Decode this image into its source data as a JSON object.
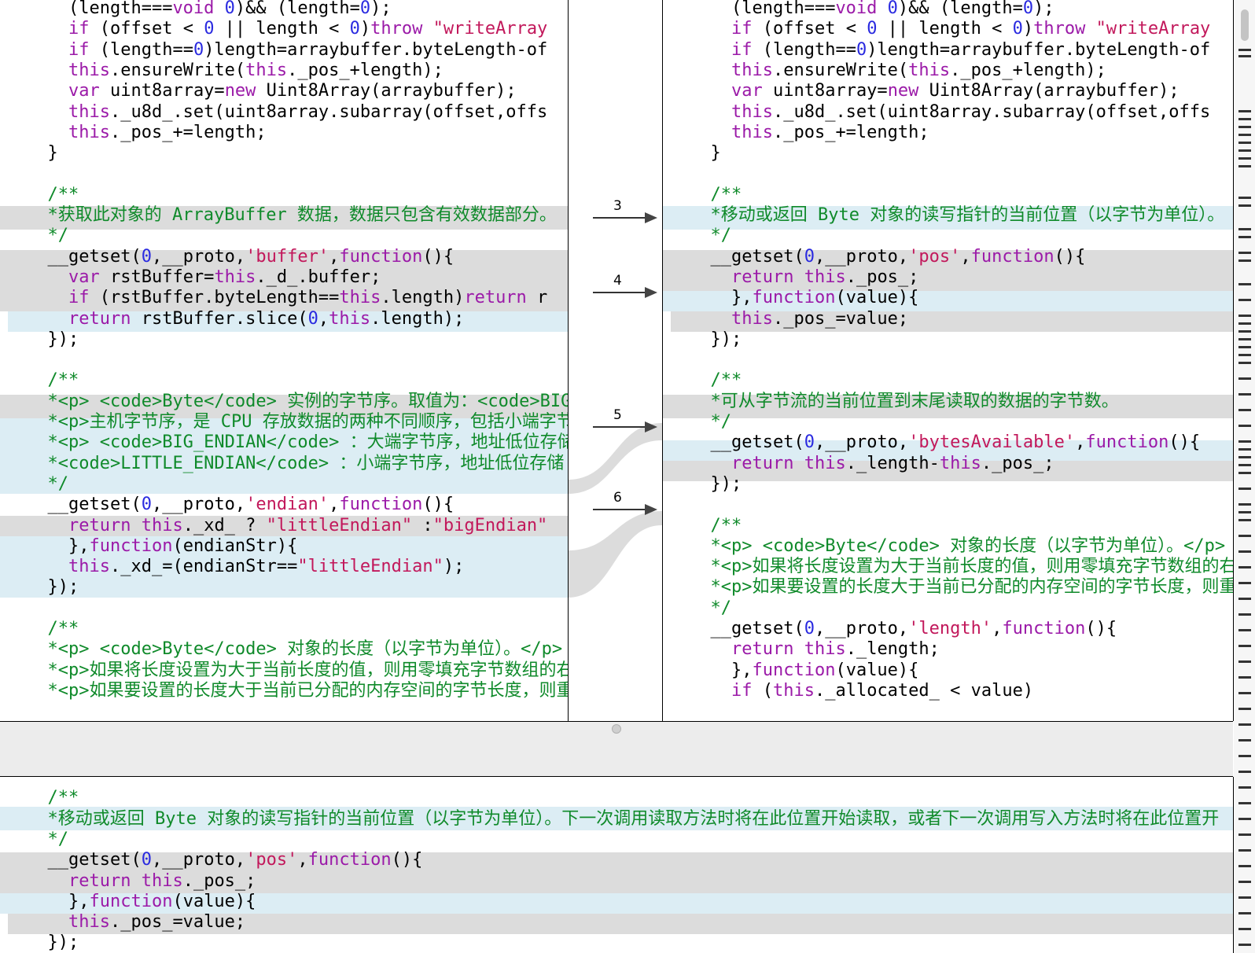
{
  "left_pane": {
    "lines": [
      {
        "indent": "    ",
        "segs": [
          [
            "t",
            "(length==="
          ],
          [
            "kw",
            "void"
          ],
          [
            "t",
            " "
          ],
          [
            "num",
            "0"
          ],
          [
            "t",
            ")&& (length="
          ],
          [
            "num",
            "0"
          ],
          [
            "t",
            ");"
          ]
        ]
      },
      {
        "indent": "    ",
        "segs": [
          [
            "kw",
            "if"
          ],
          [
            "t",
            " (offset < "
          ],
          [
            "num",
            "0"
          ],
          [
            "t",
            " || length < "
          ],
          [
            "num",
            "0"
          ],
          [
            "t",
            ")"
          ],
          [
            "kw",
            "throw"
          ],
          [
            "t",
            " "
          ],
          [
            "str",
            "\"writeArray"
          ]
        ]
      },
      {
        "indent": "    ",
        "segs": [
          [
            "kw",
            "if"
          ],
          [
            "t",
            " (length=="
          ],
          [
            "num",
            "0"
          ],
          [
            "t",
            ")length=arraybuffer.byteLength-of"
          ]
        ]
      },
      {
        "indent": "    ",
        "segs": [
          [
            "kw",
            "this"
          ],
          [
            "t",
            ".ensureWrite("
          ],
          [
            "kw",
            "this"
          ],
          [
            "t",
            "._pos_+length);"
          ]
        ]
      },
      {
        "indent": "    ",
        "segs": [
          [
            "kw",
            "var"
          ],
          [
            "t",
            " uint8array="
          ],
          [
            "kw",
            "new"
          ],
          [
            "t",
            " Uint8Array(arraybuffer);"
          ]
        ]
      },
      {
        "indent": "    ",
        "segs": [
          [
            "kw",
            "this"
          ],
          [
            "t",
            "._u8d_.set(uint8array.subarray(offset,offs"
          ]
        ]
      },
      {
        "indent": "    ",
        "segs": [
          [
            "kw",
            "this"
          ],
          [
            "t",
            "._pos_+=length;"
          ]
        ]
      },
      {
        "indent": "  ",
        "segs": [
          [
            "t",
            "}"
          ]
        ]
      },
      {
        "indent": "",
        "segs": []
      },
      {
        "indent": "  ",
        "segs": [
          [
            "cm",
            "/**"
          ]
        ]
      },
      {
        "indent": "  ",
        "segs": [
          [
            "cm",
            "*获取此对象的 ArrayBuffer 数据，数据只包含有效数据部分。"
          ]
        ]
      },
      {
        "indent": "  ",
        "segs": [
          [
            "cm",
            "*/"
          ]
        ]
      },
      {
        "indent": "  ",
        "segs": [
          [
            "t",
            "__getset("
          ],
          [
            "num",
            "0"
          ],
          [
            "t",
            ",__proto,"
          ],
          [
            "str",
            "'buffer'"
          ],
          [
            "t",
            ","
          ],
          [
            "kw",
            "function"
          ],
          [
            "t",
            "(){"
          ]
        ]
      },
      {
        "indent": "    ",
        "segs": [
          [
            "kw",
            "var"
          ],
          [
            "t",
            " rstBuffer="
          ],
          [
            "kw",
            "this"
          ],
          [
            "t",
            "._d_.buffer;"
          ]
        ]
      },
      {
        "indent": "    ",
        "segs": [
          [
            "kw",
            "if"
          ],
          [
            "t",
            " (rstBuffer.byteLength=="
          ],
          [
            "kw",
            "this"
          ],
          [
            "t",
            ".length)"
          ],
          [
            "kw",
            "return"
          ],
          [
            "t",
            " r"
          ]
        ]
      },
      {
        "indent": "    ",
        "segs": [
          [
            "kw",
            "return"
          ],
          [
            "t",
            " rstBuffer.slice("
          ],
          [
            "num",
            "0"
          ],
          [
            "t",
            ","
          ],
          [
            "kw",
            "this"
          ],
          [
            "t",
            ".length);"
          ]
        ]
      },
      {
        "indent": "  ",
        "segs": [
          [
            "t",
            "});"
          ]
        ]
      },
      {
        "indent": "",
        "segs": []
      },
      {
        "indent": "  ",
        "segs": [
          [
            "cm",
            "/**"
          ]
        ]
      },
      {
        "indent": "  ",
        "segs": [
          [
            "cm",
            "*<p> <code>Byte</code> 实例的字节序。取值为：<code>BIG"
          ]
        ]
      },
      {
        "indent": "  ",
        "segs": [
          [
            "cm",
            "*<p>主机字节序，是 CPU 存放数据的两种不同顺序，包括小端字节"
          ]
        ]
      },
      {
        "indent": "  ",
        "segs": [
          [
            "cm",
            "*<p> <code>BIG_ENDIAN</code> ：大端字节序，地址低位存储"
          ]
        ]
      },
      {
        "indent": "  ",
        "segs": [
          [
            "cm",
            "*<code>LITTLE_ENDIAN</code> ：小端字节序，地址低位存储"
          ]
        ]
      },
      {
        "indent": "  ",
        "segs": [
          [
            "cm",
            "*/"
          ]
        ]
      },
      {
        "indent": "  ",
        "segs": [
          [
            "t",
            "__getset("
          ],
          [
            "num",
            "0"
          ],
          [
            "t",
            ",__proto,"
          ],
          [
            "str",
            "'endian'"
          ],
          [
            "t",
            ","
          ],
          [
            "kw",
            "function"
          ],
          [
            "t",
            "(){"
          ]
        ]
      },
      {
        "indent": "    ",
        "segs": [
          [
            "kw",
            "return"
          ],
          [
            "t",
            " "
          ],
          [
            "kw",
            "this"
          ],
          [
            "t",
            "._xd_ ? "
          ],
          [
            "str",
            "\"littleEndian\""
          ],
          [
            "t",
            " :"
          ],
          [
            "str",
            "\"bigEndian\""
          ]
        ]
      },
      {
        "indent": "    ",
        "segs": [
          [
            "t",
            "},"
          ],
          [
            "kw",
            "function"
          ],
          [
            "t",
            "(endianStr){"
          ]
        ]
      },
      {
        "indent": "    ",
        "segs": [
          [
            "kw",
            "this"
          ],
          [
            "t",
            "._xd_=(endianStr=="
          ],
          [
            "str",
            "\"littleEndian\""
          ],
          [
            "t",
            ");"
          ]
        ]
      },
      {
        "indent": "  ",
        "segs": [
          [
            "t",
            "});"
          ]
        ]
      },
      {
        "indent": "",
        "segs": []
      },
      {
        "indent": "  ",
        "segs": [
          [
            "cm",
            "/**"
          ]
        ]
      },
      {
        "indent": "  ",
        "segs": [
          [
            "cm",
            "*<p> <code>Byte</code> 对象的长度（以字节为单位）。</p>"
          ]
        ]
      },
      {
        "indent": "  ",
        "segs": [
          [
            "cm",
            "*<p>如果将长度设置为大于当前长度的值，则用零填充字节数组的右"
          ]
        ]
      },
      {
        "indent": "  ",
        "segs": [
          [
            "cm",
            "*<p>如果要设置的长度大于当前已分配的内存空间的字节长度，则重"
          ]
        ]
      }
    ]
  },
  "right_pane": {
    "lines": [
      {
        "indent": "    ",
        "segs": [
          [
            "t",
            "(length==="
          ],
          [
            "kw",
            "void"
          ],
          [
            "t",
            " "
          ],
          [
            "num",
            "0"
          ],
          [
            "t",
            ")&& (length="
          ],
          [
            "num",
            "0"
          ],
          [
            "t",
            ");"
          ]
        ]
      },
      {
        "indent": "    ",
        "segs": [
          [
            "kw",
            "if"
          ],
          [
            "t",
            " (offset < "
          ],
          [
            "num",
            "0"
          ],
          [
            "t",
            " || length < "
          ],
          [
            "num",
            "0"
          ],
          [
            "t",
            ")"
          ],
          [
            "kw",
            "throw"
          ],
          [
            "t",
            " "
          ],
          [
            "str",
            "\"writeArray"
          ]
        ]
      },
      {
        "indent": "    ",
        "segs": [
          [
            "kw",
            "if"
          ],
          [
            "t",
            " (length=="
          ],
          [
            "num",
            "0"
          ],
          [
            "t",
            ")length=arraybuffer.byteLength-of"
          ]
        ]
      },
      {
        "indent": "    ",
        "segs": [
          [
            "kw",
            "this"
          ],
          [
            "t",
            ".ensureWrite("
          ],
          [
            "kw",
            "this"
          ],
          [
            "t",
            "._pos_+length);"
          ]
        ]
      },
      {
        "indent": "    ",
        "segs": [
          [
            "kw",
            "var"
          ],
          [
            "t",
            " uint8array="
          ],
          [
            "kw",
            "new"
          ],
          [
            "t",
            " Uint8Array(arraybuffer);"
          ]
        ]
      },
      {
        "indent": "    ",
        "segs": [
          [
            "kw",
            "this"
          ],
          [
            "t",
            "._u8d_.set(uint8array.subarray(offset,offs"
          ]
        ]
      },
      {
        "indent": "    ",
        "segs": [
          [
            "kw",
            "this"
          ],
          [
            "t",
            "._pos_+=length;"
          ]
        ]
      },
      {
        "indent": "  ",
        "segs": [
          [
            "t",
            "}"
          ]
        ]
      },
      {
        "indent": "",
        "segs": []
      },
      {
        "indent": "  ",
        "segs": [
          [
            "cm",
            "/**"
          ]
        ]
      },
      {
        "indent": "  ",
        "segs": [
          [
            "cm",
            "*移动或返回 Byte 对象的读写指针的当前位置（以字节为单位）。"
          ]
        ]
      },
      {
        "indent": "  ",
        "segs": [
          [
            "cm",
            "*/"
          ]
        ]
      },
      {
        "indent": "  ",
        "segs": [
          [
            "t",
            "__getset("
          ],
          [
            "num",
            "0"
          ],
          [
            "t",
            ",__proto,"
          ],
          [
            "str",
            "'pos'"
          ],
          [
            "t",
            ","
          ],
          [
            "kw",
            "function"
          ],
          [
            "t",
            "(){"
          ]
        ]
      },
      {
        "indent": "    ",
        "segs": [
          [
            "kw",
            "return"
          ],
          [
            "t",
            " "
          ],
          [
            "kw",
            "this"
          ],
          [
            "t",
            "._pos_;"
          ]
        ]
      },
      {
        "indent": "    ",
        "segs": [
          [
            "t",
            "},"
          ],
          [
            "kw",
            "function"
          ],
          [
            "t",
            "(value){"
          ]
        ]
      },
      {
        "indent": "    ",
        "segs": [
          [
            "kw",
            "this"
          ],
          [
            "t",
            "._pos_=value;"
          ]
        ]
      },
      {
        "indent": "  ",
        "segs": [
          [
            "t",
            "});"
          ]
        ]
      },
      {
        "indent": "",
        "segs": []
      },
      {
        "indent": "  ",
        "segs": [
          [
            "cm",
            "/**"
          ]
        ]
      },
      {
        "indent": "  ",
        "segs": [
          [
            "cm",
            "*可从字节流的当前位置到末尾读取的数据的字节数。"
          ]
        ]
      },
      {
        "indent": "  ",
        "segs": [
          [
            "cm",
            "*/"
          ]
        ]
      },
      {
        "indent": "  ",
        "segs": [
          [
            "t",
            "__getset("
          ],
          [
            "num",
            "0"
          ],
          [
            "t",
            ",__proto,"
          ],
          [
            "str",
            "'bytesAvailable'"
          ],
          [
            "t",
            ","
          ],
          [
            "kw",
            "function"
          ],
          [
            "t",
            "(){"
          ]
        ]
      },
      {
        "indent": "    ",
        "segs": [
          [
            "kw",
            "return"
          ],
          [
            "t",
            " "
          ],
          [
            "kw",
            "this"
          ],
          [
            "t",
            "._length-"
          ],
          [
            "kw",
            "this"
          ],
          [
            "t",
            "._pos_;"
          ]
        ]
      },
      {
        "indent": "  ",
        "segs": [
          [
            "t",
            "});"
          ]
        ]
      },
      {
        "indent": "",
        "segs": []
      },
      {
        "indent": "  ",
        "segs": [
          [
            "cm",
            "/**"
          ]
        ]
      },
      {
        "indent": "  ",
        "segs": [
          [
            "cm",
            "*<p> <code>Byte</code> 对象的长度（以字节为单位）。</p>"
          ]
        ]
      },
      {
        "indent": "  ",
        "segs": [
          [
            "cm",
            "*<p>如果将长度设置为大于当前长度的值，则用零填充字节数组的右"
          ]
        ]
      },
      {
        "indent": "  ",
        "segs": [
          [
            "cm",
            "*<p>如果要设置的长度大于当前已分配的内存空间的字节长度，则重"
          ]
        ]
      },
      {
        "indent": "  ",
        "segs": [
          [
            "cm",
            "*/"
          ]
        ]
      },
      {
        "indent": "  ",
        "segs": [
          [
            "t",
            "__getset("
          ],
          [
            "num",
            "0"
          ],
          [
            "t",
            ",__proto,"
          ],
          [
            "str",
            "'length'"
          ],
          [
            "t",
            ","
          ],
          [
            "kw",
            "function"
          ],
          [
            "t",
            "(){"
          ]
        ]
      },
      {
        "indent": "    ",
        "segs": [
          [
            "kw",
            "return"
          ],
          [
            "t",
            " "
          ],
          [
            "kw",
            "this"
          ],
          [
            "t",
            "._length;"
          ]
        ]
      },
      {
        "indent": "    ",
        "segs": [
          [
            "t",
            "},"
          ],
          [
            "kw",
            "function"
          ],
          [
            "t",
            "(value){"
          ]
        ]
      },
      {
        "indent": "    ",
        "segs": [
          [
            "kw",
            "if"
          ],
          [
            "t",
            " ("
          ],
          [
            "kw",
            "this"
          ],
          [
            "t",
            "._allocated_ < value)"
          ]
        ]
      }
    ]
  },
  "bottom_pane": {
    "lines": [
      {
        "indent": "",
        "segs": []
      },
      {
        "indent": "  ",
        "segs": [
          [
            "cm",
            "/**"
          ]
        ]
      },
      {
        "indent": "  ",
        "segs": [
          [
            "cm",
            "*移动或返回 Byte 对象的读写指针的当前位置（以字节为单位）。下一次调用读取方法时将在此位置开始读取，或者下一次调用写入方法时将在此位置开"
          ]
        ]
      },
      {
        "indent": "  ",
        "segs": [
          [
            "cm",
            "*/"
          ]
        ]
      },
      {
        "indent": "  ",
        "segs": [
          [
            "t",
            "__getset("
          ],
          [
            "num",
            "0"
          ],
          [
            "t",
            ",__proto,"
          ],
          [
            "str",
            "'pos'"
          ],
          [
            "t",
            ","
          ],
          [
            "kw",
            "function"
          ],
          [
            "t",
            "(){"
          ]
        ]
      },
      {
        "indent": "    ",
        "segs": [
          [
            "kw",
            "return"
          ],
          [
            "t",
            " "
          ],
          [
            "kw",
            "this"
          ],
          [
            "t",
            "._pos_;"
          ]
        ]
      },
      {
        "indent": "    ",
        "segs": [
          [
            "t",
            "},"
          ],
          [
            "kw",
            "function"
          ],
          [
            "t",
            "(value){"
          ]
        ]
      },
      {
        "indent": "    ",
        "segs": [
          [
            "kw",
            "this"
          ],
          [
            "t",
            "._pos_=value;"
          ]
        ]
      },
      {
        "indent": "  ",
        "segs": [
          [
            "t",
            "});"
          ]
        ]
      }
    ]
  },
  "diff_markers": [
    {
      "label": "3"
    },
    {
      "label": "4"
    },
    {
      "label": "5"
    },
    {
      "label": "6"
    }
  ]
}
